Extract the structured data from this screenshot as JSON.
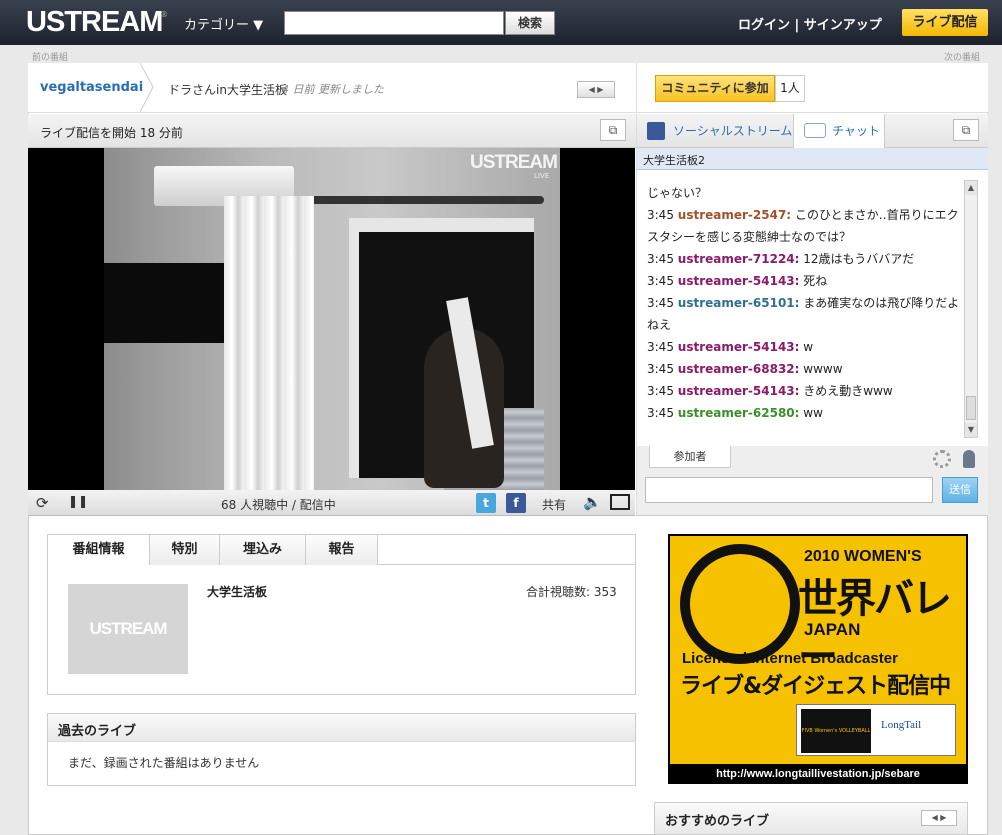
{
  "header": {
    "logo": "USTREAM",
    "category_label": "カテゴリー ▼",
    "search_placeholder": "",
    "search_button": "検索",
    "auth_links": "ログイン | サインアップ",
    "live_button": "ライブ配信"
  },
  "nav": {
    "prev": "前の番組",
    "next": "次の番組"
  },
  "channel": {
    "name": "vegaltasendai",
    "show_title": "ドラさんin大学生活板",
    "updated": "4 日前 更新しました",
    "nav_arrows": "◀ ▶"
  },
  "broadcast": {
    "started": "ライブ配信を開始 18 分前"
  },
  "video": {
    "watermark": "USTREAM",
    "watermark_live": "LIVE",
    "status": "68 人視聴中 / 配信中",
    "share": "共有"
  },
  "community": {
    "join_button": "コミュニティに参加",
    "member_count": "1人"
  },
  "chat": {
    "tab_social": "ソーシャルストリーム",
    "tab_chat": "チャット",
    "room_name": "大学生活板2",
    "messages": [
      {
        "text": "じゃない？"
      },
      {
        "time": "3:45",
        "user": "ustreamer-2547:",
        "color": "#a0522d",
        "text": "このひとまさか‥首吊りにエクスタシーを感じる変態紳士なのでは？"
      },
      {
        "time": "3:45",
        "user": "ustreamer-71224:",
        "color": "#8b1a6b",
        "text": "12歳はもうババアだ"
      },
      {
        "time": "3:45",
        "user": "ustreamer-54143:",
        "color": "#8b1a6b",
        "text": "死ね"
      },
      {
        "time": "3:45",
        "user": "ustreamer-65101:",
        "color": "#2f6f8f",
        "text": "まあ確実なのは飛び降りだよねえ"
      },
      {
        "time": "3:45",
        "user": "ustreamer-54143:",
        "color": "#8b1a6b",
        "text": "w"
      },
      {
        "time": "3:45",
        "user": "ustreamer-68832:",
        "color": "#8b1a6b",
        "text": "wwww"
      },
      {
        "time": "3:45",
        "user": "ustreamer-54143:",
        "color": "#8b1a6b",
        "text": "きめえ動きwww"
      },
      {
        "time": "3:45",
        "user": "ustreamer-62580:",
        "color": "#3a8f2a",
        "text": "ww"
      }
    ],
    "participants_tab": "参加者",
    "send_button": "送信"
  },
  "info": {
    "tabs": [
      "番組情報",
      "特別",
      "埋込み",
      "報告"
    ],
    "thumb_text": "USTREAM",
    "title": "大学生活板",
    "total_views": "合計視聴数: 353"
  },
  "past": {
    "heading": "過去のライブ",
    "empty": "まだ、録画された番組はありません"
  },
  "ad": {
    "line1": "2010 WOMEN'S",
    "line2": "世界バレー",
    "line3": "JAPAN",
    "line4": "Licensed Internet Broadcaster",
    "line5": "ライブ&ダイジェスト配信中",
    "logo_a": "FIVB Women's VOLLEYBALL WORLD CHAMPIONSHIP JAPAN 2010",
    "logo_b": "LongTail",
    "url": "http://www.longtaillivestation.jp/sebare"
  },
  "recommended": {
    "title": "おすすめのライブ",
    "nav": "◀ ▶"
  }
}
